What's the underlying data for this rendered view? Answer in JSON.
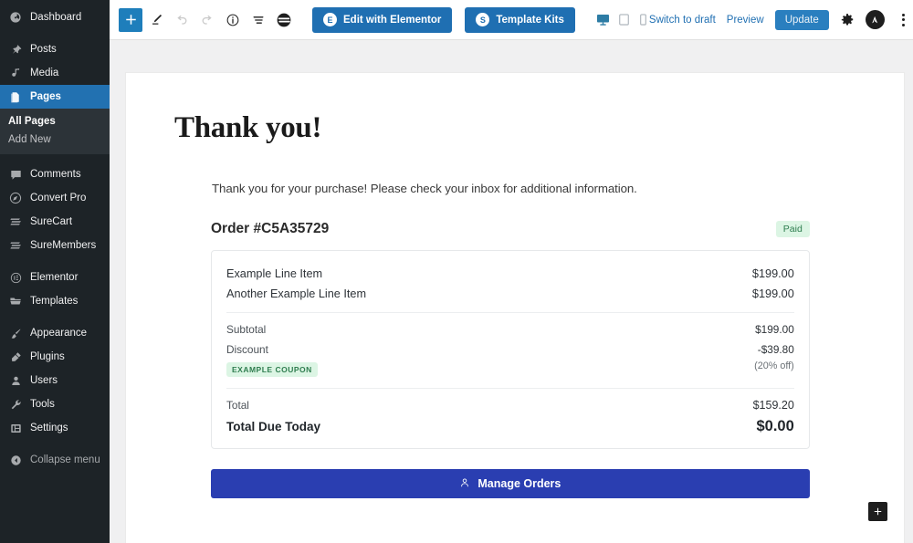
{
  "sidebar": {
    "items": [
      {
        "label": "Dashboard",
        "icon": "dashboard-icon",
        "active": false
      },
      {
        "label": "Posts",
        "icon": "pin-icon",
        "active": false
      },
      {
        "label": "Media",
        "icon": "media-icon",
        "active": false
      },
      {
        "label": "Pages",
        "icon": "pages-icon",
        "active": true
      },
      {
        "label": "Comments",
        "icon": "comment-icon",
        "active": false
      },
      {
        "label": "Convert Pro",
        "icon": "convertpro-icon",
        "active": false
      },
      {
        "label": "SureCart",
        "icon": "surecart-icon",
        "active": false
      },
      {
        "label": "SureMembers",
        "icon": "suremembers-icon",
        "active": false
      },
      {
        "label": "Elementor",
        "icon": "elementor-icon",
        "active": false
      },
      {
        "label": "Templates",
        "icon": "folder-icon",
        "active": false
      },
      {
        "label": "Appearance",
        "icon": "brush-icon",
        "active": false
      },
      {
        "label": "Plugins",
        "icon": "plug-icon",
        "active": false
      },
      {
        "label": "Users",
        "icon": "user-icon",
        "active": false
      },
      {
        "label": "Tools",
        "icon": "wrench-icon",
        "active": false
      },
      {
        "label": "Settings",
        "icon": "settings-icon",
        "active": false
      }
    ],
    "submenu": {
      "all_pages": "All Pages",
      "add_new": "Add New"
    },
    "collapse": {
      "label": "Collapse menu",
      "icon": "collapse-icon"
    }
  },
  "toolbar": {
    "add_block_title": "+",
    "icons": [
      "add-block-icon",
      "edit-tool-icon",
      "undo-icon",
      "redo-icon",
      "details-icon",
      "list-view-icon",
      "logo-icon"
    ],
    "edit_elementor": "Edit with Elementor",
    "template_kits": "Template Kits",
    "devices": [
      "desktop-icon",
      "tablet-icon",
      "mobile-icon"
    ],
    "switch_to_draft": "Switch to draft",
    "preview": "Preview",
    "update": "Update",
    "settings_icon": "gear-icon",
    "astra_icon": "astra-logo-icon",
    "options_icon": "kebab-menu-icon"
  },
  "page": {
    "title": "Thank you!",
    "intro": "Thank you for your purchase! Please check your inbox for additional information.",
    "order": {
      "number": "Order #C5A35729",
      "status_badge": "Paid",
      "line_items": [
        {
          "name": "Example Line Item",
          "price": "$199.00"
        },
        {
          "name": "Another Example Line Item",
          "price": "$199.00"
        }
      ],
      "summary": [
        {
          "label": "Subtotal",
          "value": "$199.00"
        },
        {
          "label": "Discount",
          "value": "-$39.80",
          "sub_value": "(20% off)",
          "coupon": "EXAMPLE COUPON"
        }
      ],
      "total": {
        "label": "Total",
        "value": "$159.20"
      },
      "due_today": {
        "label": "Total Due Today",
        "value": "$0.00"
      }
    },
    "manage_orders_button": "Manage Orders",
    "manage_orders_icon": "person-icon",
    "add_block_button": "+"
  },
  "colors": {
    "admin_bg": "#1d2327",
    "admin_active": "#2271b1",
    "accent_blue": "#1f6fb2",
    "button_indigo": "#2a3eb1",
    "badge_green_bg": "#dcf5e4",
    "badge_green_text": "#2e7d4f",
    "canvas_bg": "#f0f0f1"
  }
}
